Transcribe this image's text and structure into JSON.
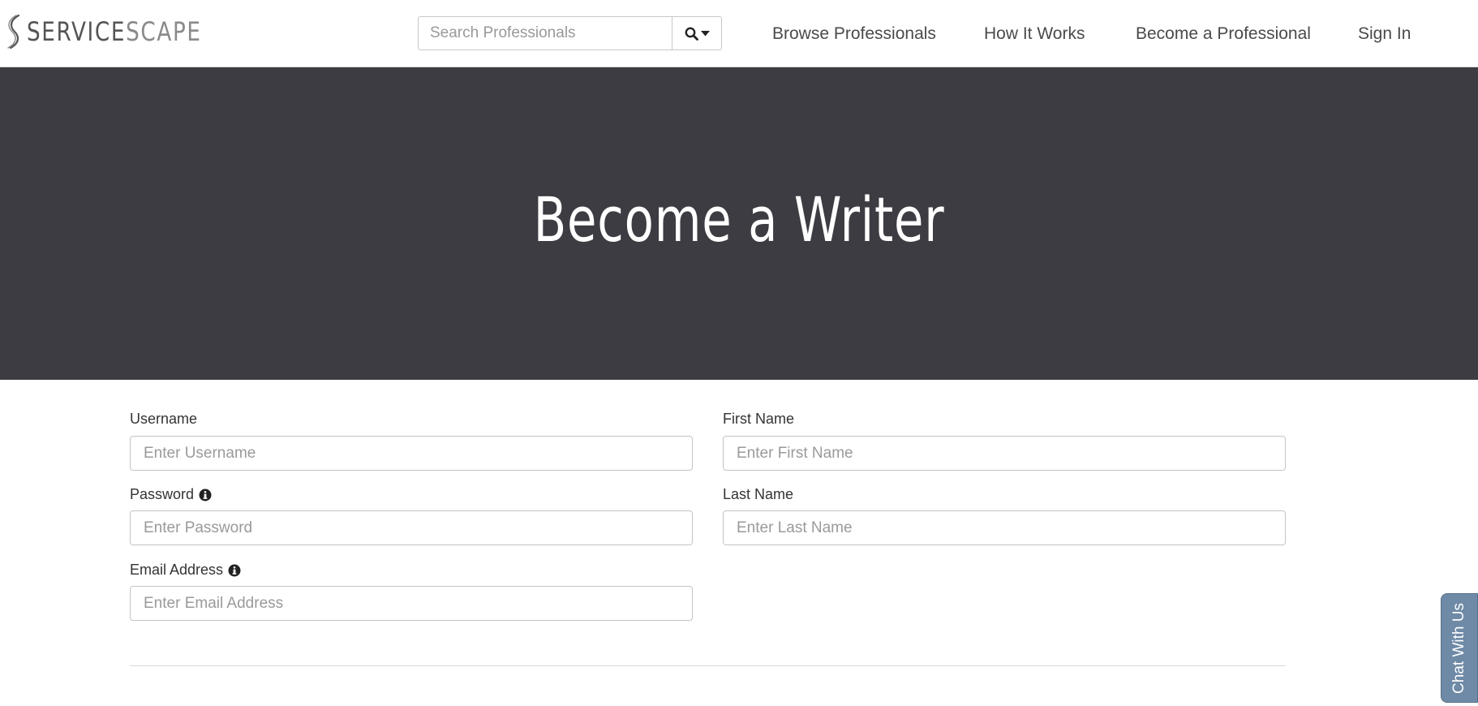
{
  "header": {
    "logo": {
      "part1": "SERVICE",
      "part2": "SCAPE"
    },
    "search": {
      "placeholder": "Search Professionals"
    },
    "nav": [
      {
        "label": "Browse Professionals"
      },
      {
        "label": "How It Works"
      },
      {
        "label": "Become a Professional"
      },
      {
        "label": "Sign In"
      }
    ]
  },
  "hero": {
    "title": "Become a Writer"
  },
  "form": {
    "username": {
      "label": "Username",
      "placeholder": "Enter Username"
    },
    "password": {
      "label": "Password",
      "placeholder": "Enter Password"
    },
    "email": {
      "label": "Email Address",
      "placeholder": "Enter Email Address"
    },
    "first_name": {
      "label": "First Name",
      "placeholder": "Enter First Name"
    },
    "last_name": {
      "label": "Last Name",
      "placeholder": "Enter Last Name"
    }
  },
  "chat": {
    "label": "Chat With Us"
  },
  "colors": {
    "hero_bg": "#3d3c42",
    "chat_bg": "#6e8aa6",
    "logo_dark": "#555555",
    "logo_light": "#8a8a8a"
  },
  "icons": {
    "logo_mark": "s-curve-logo-icon",
    "search": "search-icon",
    "dropdown": "caret-down-icon",
    "info": "info-circle-icon"
  }
}
